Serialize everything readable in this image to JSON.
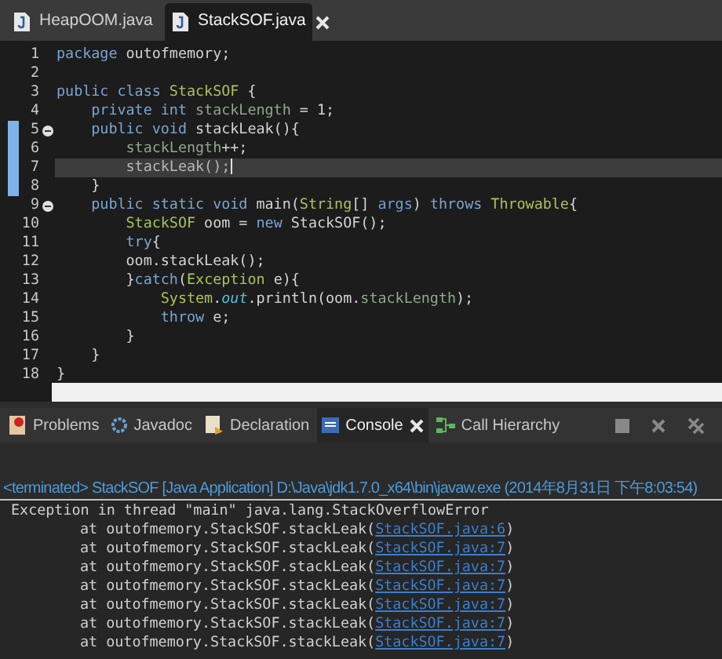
{
  "editor_tabs": [
    {
      "label": "HeapOOM.java",
      "selected": false
    },
    {
      "label": "StackSOF.java",
      "selected": true
    }
  ],
  "code_lines": [
    {
      "number": "1",
      "changed": false,
      "current": false,
      "fold": false,
      "tokens": [
        {
          "kind": "keyword",
          "text": "package"
        },
        {
          "kind": "plain",
          "text": " outofmemory;"
        }
      ]
    },
    {
      "number": "2",
      "changed": false,
      "current": false,
      "fold": false
    },
    {
      "number": "3",
      "changed": false,
      "current": false,
      "fold": false,
      "tokens": [
        {
          "kind": "keyword",
          "text": "public class "
        },
        {
          "kind": "type",
          "text": "StackSOF"
        },
        {
          "kind": "plain",
          "text": " {"
        }
      ]
    },
    {
      "number": "4",
      "changed": false,
      "current": false,
      "fold": false,
      "tokens": [
        {
          "kind": "keyword",
          "text": "    private int "
        },
        {
          "kind": "field",
          "text": "stackLength"
        },
        {
          "kind": "plain",
          "text": " = 1;"
        }
      ]
    },
    {
      "number": "5",
      "changed": true,
      "current": false,
      "fold": true,
      "tokens": [
        {
          "kind": "keyword",
          "text": "    public void"
        },
        {
          "kind": "plain",
          "text": " stackLeak(){"
        }
      ]
    },
    {
      "number": "6",
      "changed": true,
      "current": false,
      "fold": false,
      "tokens": [
        {
          "kind": "field",
          "text": "        stackLength"
        },
        {
          "kind": "plain",
          "text": "++;"
        }
      ]
    },
    {
      "number": "7",
      "changed": true,
      "current": true,
      "fold": false,
      "tokens": [
        {
          "kind": "method",
          "text": "        stackLeak();"
        }
      ]
    },
    {
      "number": "8",
      "changed": true,
      "current": false,
      "fold": false,
      "tokens": [
        {
          "kind": "plain",
          "text": "    }"
        }
      ]
    },
    {
      "number": "9",
      "changed": false,
      "current": false,
      "fold": true,
      "tokens": [
        {
          "kind": "keyword",
          "text": "    public static void"
        },
        {
          "kind": "plain",
          "text": " main("
        },
        {
          "kind": "type",
          "text": "String"
        },
        {
          "kind": "plain",
          "text": "[] "
        },
        {
          "kind": "param",
          "text": "args"
        },
        {
          "kind": "plain",
          "text": ") "
        },
        {
          "kind": "keyword",
          "text": "throws "
        },
        {
          "kind": "type",
          "text": "Throwable"
        },
        {
          "kind": "plain",
          "text": "{"
        }
      ]
    },
    {
      "number": "10",
      "changed": false,
      "current": false,
      "fold": false,
      "tokens": [
        {
          "kind": "type",
          "text": "        StackSOF"
        },
        {
          "kind": "plain",
          "text": " oom = "
        },
        {
          "kind": "keyword",
          "text": "new"
        },
        {
          "kind": "plain",
          "text": " StackSOF();"
        }
      ]
    },
    {
      "number": "11",
      "changed": false,
      "current": false,
      "fold": false,
      "tokens": [
        {
          "kind": "keyword",
          "text": "        try"
        },
        {
          "kind": "plain",
          "text": "{"
        }
      ]
    },
    {
      "number": "12",
      "changed": false,
      "current": false,
      "fold": false,
      "tokens": [
        {
          "kind": "plain",
          "text": "        oom.stackLeak();"
        }
      ]
    },
    {
      "number": "13",
      "changed": false,
      "current": false,
      "fold": false,
      "tokens": [
        {
          "kind": "plain",
          "text": "        }"
        },
        {
          "kind": "keyword",
          "text": "catch"
        },
        {
          "kind": "plain",
          "text": "("
        },
        {
          "kind": "type",
          "text": "Exception"
        },
        {
          "kind": "plain",
          "text": " e){"
        }
      ]
    },
    {
      "number": "14",
      "changed": false,
      "current": false,
      "fold": false,
      "tokens": [
        {
          "kind": "type",
          "text": "            System"
        },
        {
          "kind": "plain",
          "text": "."
        },
        {
          "kind": "static",
          "text": "out"
        },
        {
          "kind": "plain",
          "text": ".println(oom."
        },
        {
          "kind": "field",
          "text": "stackLength"
        },
        {
          "kind": "plain",
          "text": ");"
        }
      ]
    },
    {
      "number": "15",
      "changed": false,
      "current": false,
      "fold": false,
      "tokens": [
        {
          "kind": "keyword",
          "text": "            throw"
        },
        {
          "kind": "plain",
          "text": " e;"
        }
      ]
    },
    {
      "number": "16",
      "changed": false,
      "current": false,
      "fold": false,
      "tokens": [
        {
          "kind": "plain",
          "text": "        }"
        }
      ]
    },
    {
      "number": "17",
      "changed": false,
      "current": false,
      "fold": false,
      "tokens": [
        {
          "kind": "plain",
          "text": "    }"
        }
      ]
    },
    {
      "number": "18",
      "changed": false,
      "current": false,
      "fold": false,
      "tokens": [
        {
          "kind": "plain",
          "text": "}"
        }
      ]
    }
  ],
  "panel_tabs": [
    {
      "label": "Problems",
      "kind": "problems",
      "selected": false
    },
    {
      "label": "Javadoc",
      "kind": "javadoc",
      "selected": false
    },
    {
      "label": "Declaration",
      "kind": "declaration",
      "selected": false
    },
    {
      "label": "Console",
      "kind": "console",
      "selected": true
    },
    {
      "label": "Call Hierarchy",
      "kind": "hierarchy",
      "selected": false
    }
  ],
  "console": {
    "status": "<terminated> StackSOF [Java Application] D:\\Java\\jdk1.7.0_x64\\bin\\javaw.exe (2014年8月31日 下午8:03:54)",
    "lines": [
      {
        "kind": "error",
        "text": "Exception in thread \"main\" java.lang.StackOverflowError"
      },
      {
        "kind": "trace",
        "text": "at outofmemory.StackSOF.stackLeak(",
        "link": "StackSOF.java:6",
        "end": ")"
      },
      {
        "kind": "trace",
        "text": "at outofmemory.StackSOF.stackLeak(",
        "link": "StackSOF.java:7",
        "end": ")"
      },
      {
        "kind": "trace",
        "text": "at outofmemory.StackSOF.stackLeak(",
        "link": "StackSOF.java:7",
        "end": ")"
      },
      {
        "kind": "trace",
        "text": "at outofmemory.StackSOF.stackLeak(",
        "link": "StackSOF.java:7",
        "end": ")"
      },
      {
        "kind": "trace",
        "text": "at outofmemory.StackSOF.stackLeak(",
        "link": "StackSOF.java:7",
        "end": ")"
      },
      {
        "kind": "trace",
        "text": "at outofmemory.StackSOF.stackLeak(",
        "link": "StackSOF.java:7",
        "end": ")"
      },
      {
        "kind": "trace",
        "text": "at outofmemory.StackSOF.stackLeak(",
        "link": "StackSOF.java:7",
        "end": ")"
      }
    ]
  }
}
